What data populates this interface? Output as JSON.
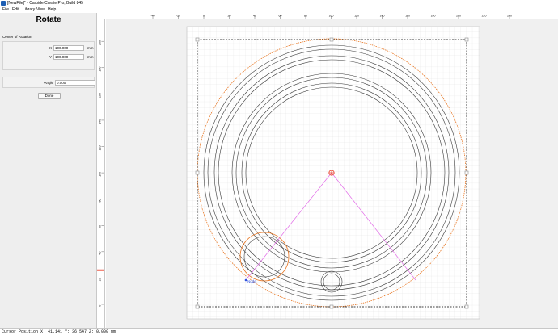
{
  "window": {
    "title": "[NewFile]* - Carbide Create Pro, Build 845"
  },
  "menu": {
    "items": [
      "File",
      "Edit",
      "Library",
      "View",
      "Help"
    ]
  },
  "panel": {
    "title": "Rotate",
    "center_label": "Center of Rotation",
    "x_label": "X",
    "x_value": "100.000",
    "x_unit": "mm",
    "y_label": "Y",
    "y_value": "100.000",
    "y_unit": "mm",
    "angle_label": "Angle",
    "angle_value": "0.000",
    "done_label": "Done"
  },
  "rulers": {
    "h_ticks": [
      "-40",
      "-20",
      "0",
      "20",
      "40",
      "60",
      "80",
      "100",
      "120",
      "140",
      "160",
      "180",
      "200",
      "220",
      "240"
    ],
    "v_ticks": [
      "200",
      "180",
      "160",
      "140",
      "120",
      "100",
      "80",
      "60",
      "40",
      "20",
      "0"
    ]
  },
  "canvas": {
    "node_label": "Node",
    "colors": {
      "geometry": "#3a3a3a",
      "orange": "#e8741e",
      "magenta": "#e26be8",
      "red": "#e8361e",
      "handle": "#888888",
      "selection": "#000000",
      "node": "#2f52e0"
    }
  },
  "status": {
    "text": "Cursor Position X: 41.141 Y: 36.547 Z: 0.000 mm"
  }
}
